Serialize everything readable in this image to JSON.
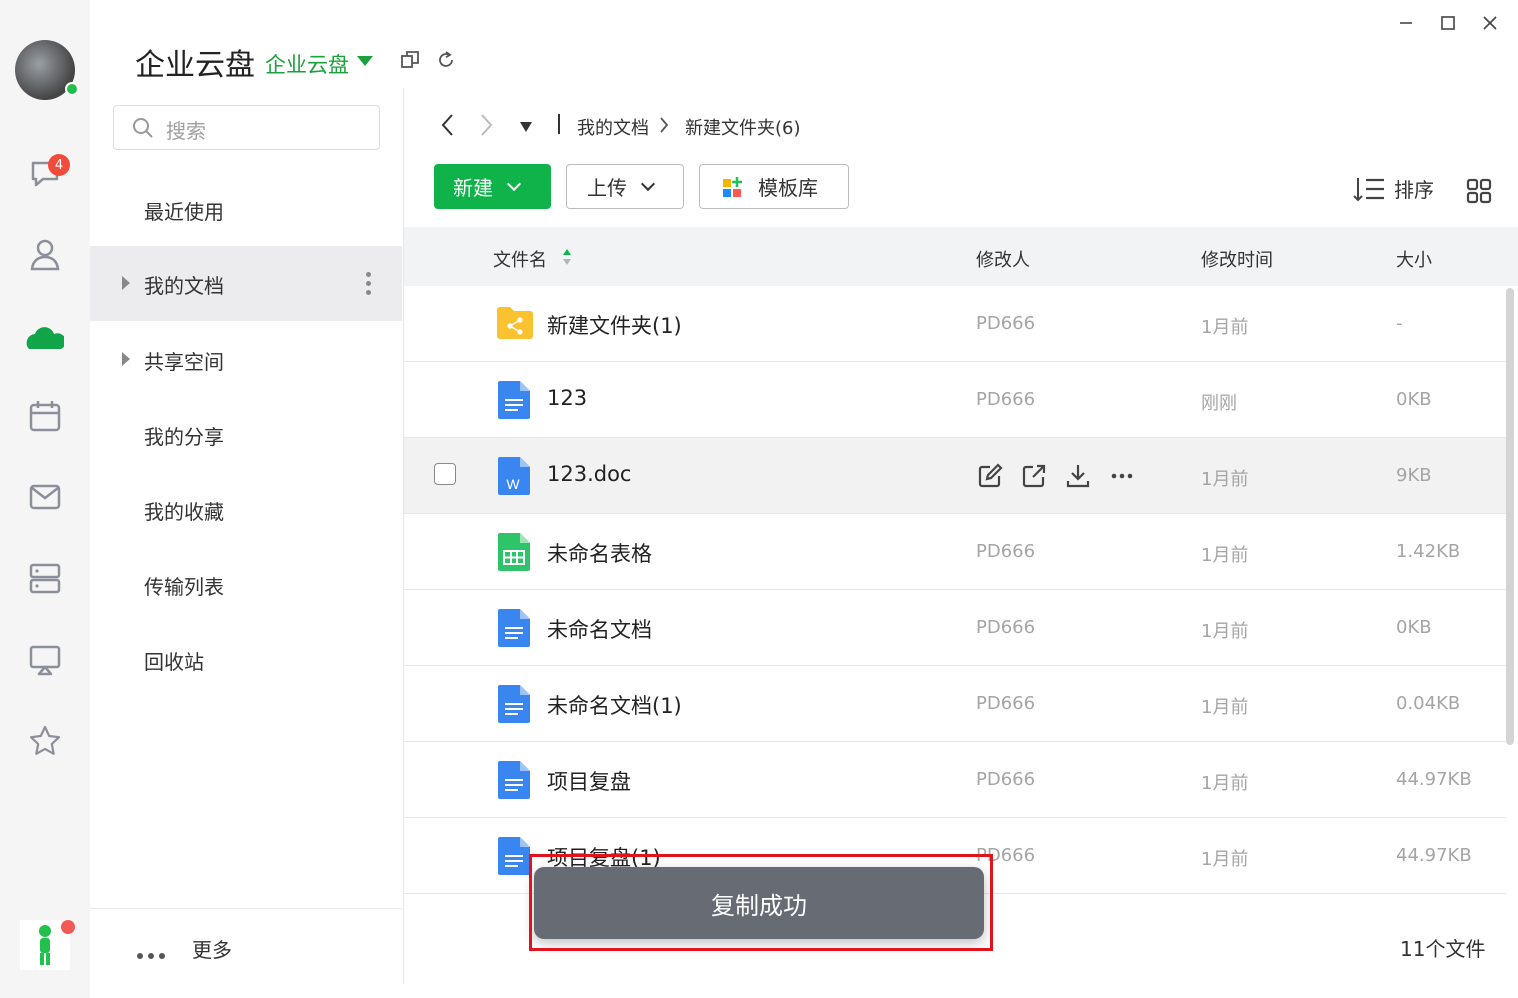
{
  "app": {
    "title": "企业云盘",
    "subtitle": "企业云盘",
    "accent_color": "#10b34a"
  },
  "rail": {
    "chat_badge": "4",
    "icons": [
      "chat-icon",
      "contacts-icon",
      "cloud-drive-icon",
      "calendar-icon",
      "mail-icon",
      "workbench-icon",
      "screen-share-icon",
      "favorites-icon"
    ]
  },
  "sidebar": {
    "search_placeholder": "搜索",
    "items": [
      {
        "label": "最近使用"
      },
      {
        "label": "我的文档"
      },
      {
        "label": "共享空间"
      },
      {
        "label": "我的分享"
      },
      {
        "label": "我的收藏"
      },
      {
        "label": "传输列表"
      },
      {
        "label": "回收站"
      }
    ],
    "more_label": "更多"
  },
  "breadcrumb": {
    "root": "我的文档",
    "current": "新建文件夹(6)"
  },
  "toolbar": {
    "new_label": "新建",
    "upload_label": "上传",
    "template_label": "模板库",
    "sort_label": "排序"
  },
  "table": {
    "headers": {
      "name": "文件名",
      "modifier": "修改人",
      "time": "修改时间",
      "size": "大小"
    },
    "rows": [
      {
        "name": "新建文件夹(1)",
        "modifier": "PD666",
        "time": "1月前",
        "size": "-",
        "type": "shared-folder"
      },
      {
        "name": "123",
        "modifier": "PD666",
        "time": "刚刚",
        "size": "0KB",
        "type": "doc"
      },
      {
        "name": "123.doc",
        "modifier": "PD666",
        "time": "1月前",
        "size": "9KB",
        "type": "word"
      },
      {
        "name": "未命名表格",
        "modifier": "PD666",
        "time": "1月前",
        "size": "1.42KB",
        "type": "sheet"
      },
      {
        "name": "未命名文档",
        "modifier": "PD666",
        "time": "1月前",
        "size": "0KB",
        "type": "doc"
      },
      {
        "name": "未命名文档(1)",
        "modifier": "PD666",
        "time": "1月前",
        "size": "0.04KB",
        "type": "doc"
      },
      {
        "name": "项目复盘",
        "modifier": "PD666",
        "time": "1月前",
        "size": "44.97KB",
        "type": "doc"
      },
      {
        "name": "项目复盘(1)",
        "modifier": "PD666",
        "time": "1月前",
        "size": "44.97KB",
        "type": "doc"
      }
    ],
    "file_count": "11个文件"
  },
  "toast": {
    "message": "复制成功"
  }
}
